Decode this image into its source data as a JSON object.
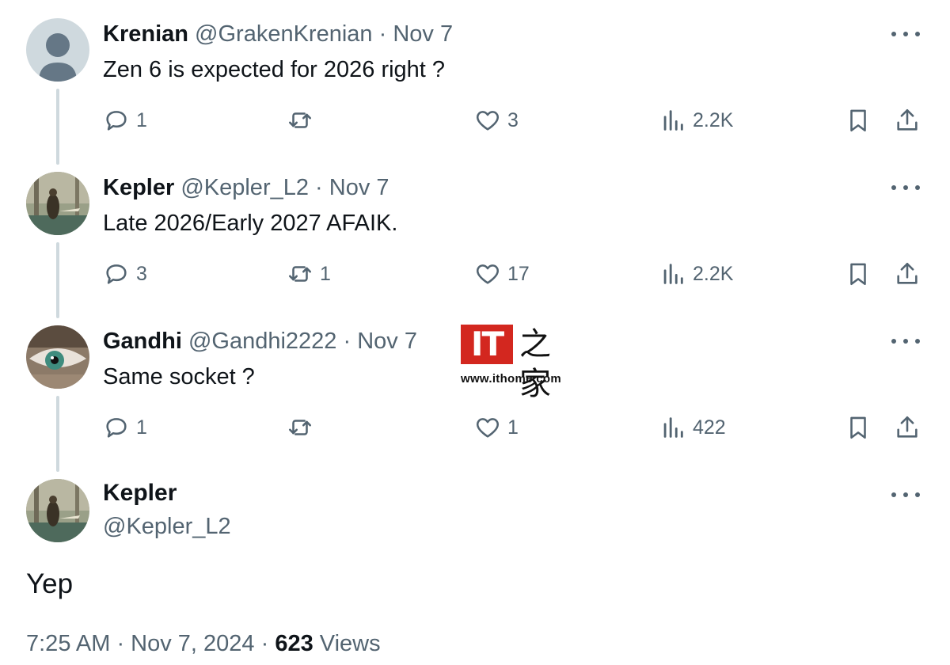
{
  "tweets": [
    {
      "name": "Krenian",
      "handle": "@GrakenKrenian",
      "date": "· Nov 7",
      "text": "Zen 6 is expected for 2026 right ?",
      "replies": "1",
      "reposts": "",
      "likes": "3",
      "views": "2.2K"
    },
    {
      "name": "Kepler",
      "handle": "@Kepler_L2",
      "date": "· Nov 7",
      "text": "Late 2026/Early 2027 AFAIK.",
      "replies": "3",
      "reposts": "1",
      "likes": "17",
      "views": "2.2K"
    },
    {
      "name": "Gandhi",
      "handle": "@Gandhi2222",
      "date": "· Nov 7",
      "text": "Same socket ?",
      "replies": "1",
      "reposts": "",
      "likes": "1",
      "views": "422"
    }
  ],
  "main": {
    "name": "Kepler",
    "handle": "@Kepler_L2",
    "text": "Yep",
    "time": "7:25 AM · Nov 7, 2024 · ",
    "view_count": "623",
    "views_label": " Views"
  },
  "watermark": {
    "logo_text": "IT",
    "logo_cn": "之家",
    "url": "www.ithome.com"
  },
  "colors": {
    "text": "#0f1419",
    "secondary": "#536471",
    "thread_line": "#cfd9de",
    "watermark_red": "#d3271f"
  },
  "icons": [
    "reply-icon",
    "repost-icon",
    "like-icon",
    "views-icon",
    "bookmark-icon",
    "share-icon",
    "more-icon"
  ]
}
